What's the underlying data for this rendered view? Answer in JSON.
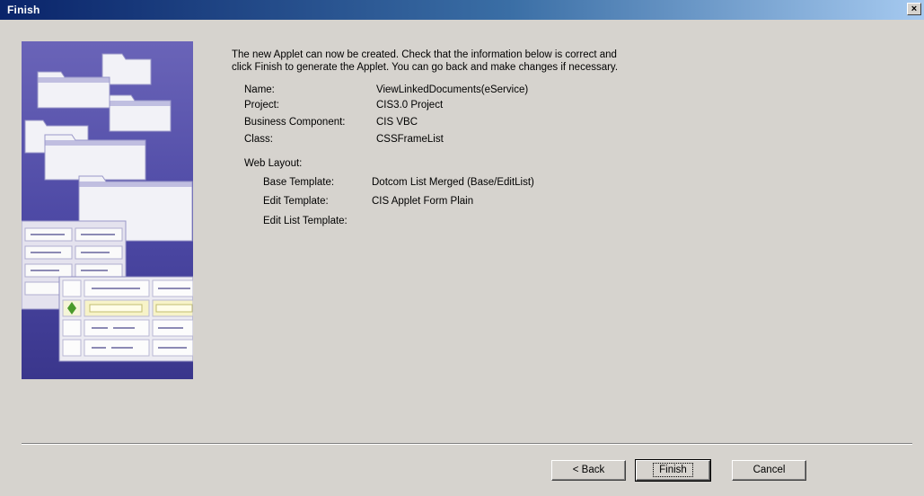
{
  "window": {
    "title": "Finish",
    "close_glyph": "×"
  },
  "intro": {
    "line1": "The new Applet can now be created. Check that the information below is correct and",
    "line2": "click Finish to generate the Applet.  You can go back and make changes if necessary."
  },
  "summary": {
    "name_label": "Name:",
    "name_value": "ViewLinkedDocuments(eService)",
    "project_label": "Project:",
    "project_value": "CIS3.0 Project",
    "business_component_label": "Business Component:",
    "business_component_value": "CIS VBC",
    "class_label": "Class:",
    "class_value": "CSSFrameList",
    "web_layout_label": "Web Layout:",
    "base_template_label": "Base Template:",
    "base_template_value": "Dotcom List Merged (Base/EditList)",
    "edit_template_label": "Edit Template:",
    "edit_template_value": "CIS Applet Form Plain",
    "edit_list_template_label": "Edit List Template:",
    "edit_list_template_value": ""
  },
  "buttons": {
    "back": "< Back",
    "finish": "Finish",
    "cancel": "Cancel"
  },
  "illustration": {
    "icon": "folders-and-form-illustration",
    "background_color": "#4c48a4"
  }
}
